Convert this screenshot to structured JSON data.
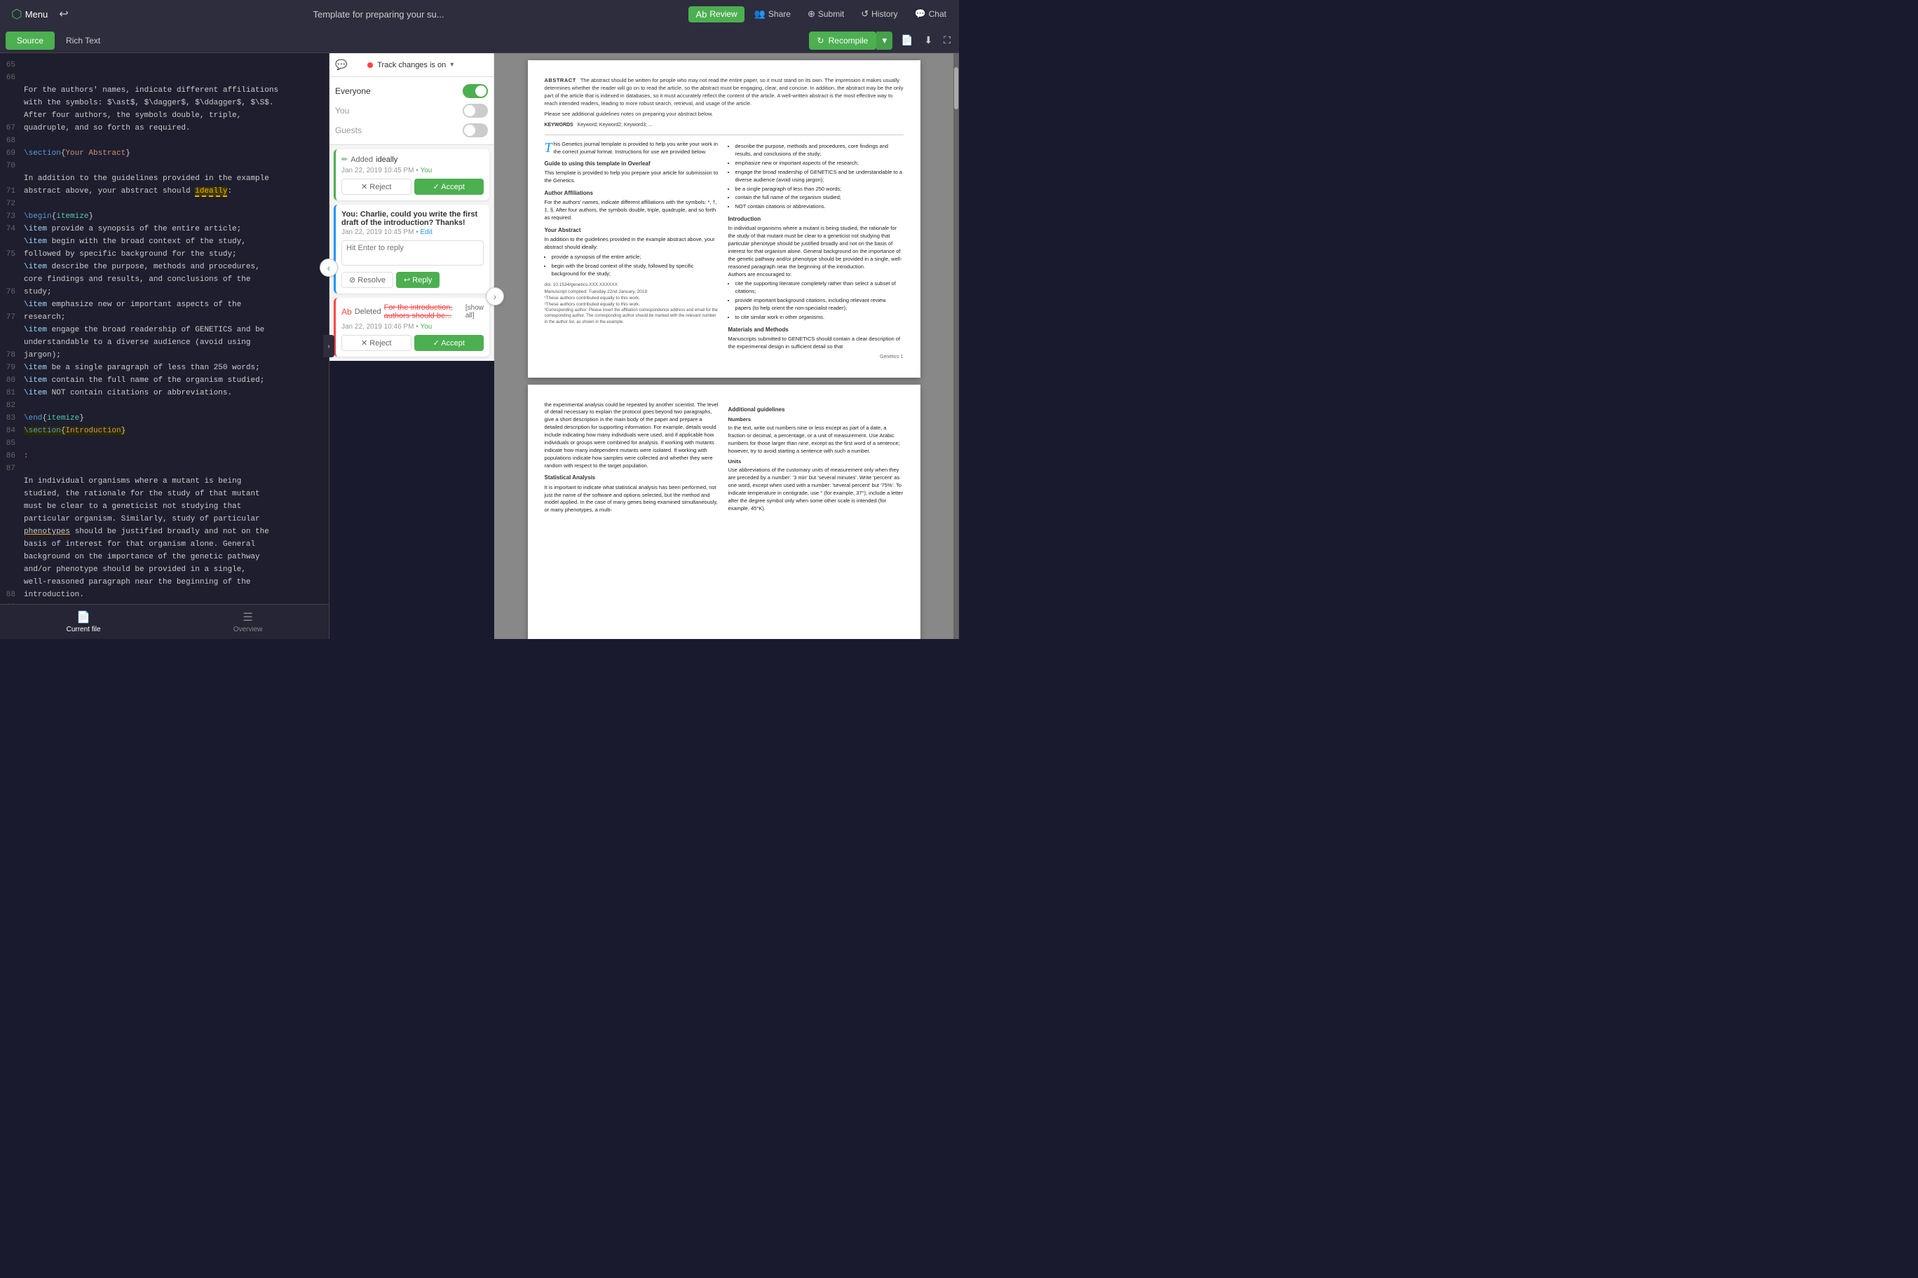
{
  "topbar": {
    "menu_label": "Menu",
    "title": "Template for preparing your su...",
    "review_label": "Review",
    "share_label": "Share",
    "submit_label": "Submit",
    "history_label": "History",
    "chat_label": "Chat"
  },
  "editor_tabs": {
    "source_label": "Source",
    "richtext_label": "Rich Text"
  },
  "toolbar": {
    "recompile_label": "Recompile"
  },
  "track_changes": {
    "indicator": "Track changes is on",
    "everyone_label": "Everyone",
    "you_label": "You",
    "guests_label": "Guests"
  },
  "change_card_1": {
    "action": "Added",
    "text": "ideally",
    "meta": "Jan 22, 2019 10:45 PM",
    "author": "You",
    "reject_label": "✕ Reject",
    "accept_label": "✓ Accept"
  },
  "comment_card": {
    "author": "You:",
    "body": "Charlie, could you write the first draft of the introduction? Thanks!",
    "meta": "Jan 22, 2019 10:45 PM",
    "edit": "Edit",
    "reply_placeholder": "Hit Enter to reply",
    "resolve_label": "⊘ Resolve",
    "reply_label": "↩ Reply"
  },
  "change_card_2": {
    "action": "Deleted",
    "text": "For the introduction, authors should be...",
    "show_all": "[show all]",
    "meta": "Jan 22, 2019 10:46 PM",
    "author": "You",
    "reject_label": "✕ Reject",
    "accept_label": "✓ Accept"
  },
  "bottom_tabs": {
    "current_file_label": "Current file",
    "overview_label": "Overview"
  },
  "code_lines": [
    {
      "num": "65",
      "content": ""
    },
    {
      "num": "66",
      "content": "For the authors' names, indicate different affiliations"
    },
    {
      "num": "",
      "content": "with the symbols: $\\ast$, $\\dagger$, $\\ddagger$, $\\S$."
    },
    {
      "num": "",
      "content": "After four authors, the symbols double, triple,"
    },
    {
      "num": "",
      "content": "quadruple, and so forth as required."
    },
    {
      "num": "67",
      "content": ""
    },
    {
      "num": "68",
      "content": "\\section{Your Abstract}",
      "type": "section"
    },
    {
      "num": "69",
      "content": ""
    },
    {
      "num": "70",
      "content": "In addition to the guidelines provided in the example"
    },
    {
      "num": "",
      "content": "abstract above, your abstract should ideally:"
    },
    {
      "num": "71",
      "content": ""
    },
    {
      "num": "72",
      "content": "\\begin{itemize}",
      "type": "keyword"
    },
    {
      "num": "73",
      "content": "\\item provide a synopsis of the entire article;"
    },
    {
      "num": "74",
      "content": "\\item begin with the broad context of the study,"
    },
    {
      "num": "",
      "content": "followed by specific background for the study;"
    },
    {
      "num": "75",
      "content": "\\item describe the purpose, methods and procedures,"
    },
    {
      "num": "",
      "content": "core findings and results, and conclusions of the"
    },
    {
      "num": "",
      "content": "study;"
    },
    {
      "num": "76",
      "content": "\\item emphasize new or important aspects of the"
    },
    {
      "num": "",
      "content": "research;"
    },
    {
      "num": "77",
      "content": "\\item engage the broad readership of GENETICS and be"
    },
    {
      "num": "",
      "content": "understandable to a diverse audience (avoid using"
    },
    {
      "num": "",
      "content": "jargon);"
    },
    {
      "num": "78",
      "content": "\\item be a single paragraph of less than 250 words;"
    },
    {
      "num": "79",
      "content": "\\item contain the full name of the organism studied;"
    },
    {
      "num": "80",
      "content": "\\item NOT contain citations or abbreviations."
    },
    {
      "num": "81",
      "content": ""
    },
    {
      "num": "82",
      "content": "\\end{itemize}",
      "type": "keyword"
    },
    {
      "num": "83",
      "content": "\\section{Introduction}",
      "type": "section_highlight"
    },
    {
      "num": "84",
      "content": ""
    },
    {
      "num": "85",
      "content": ":",
      "type": "error"
    },
    {
      "num": "86",
      "content": ""
    },
    {
      "num": "87",
      "content": "In individual organisms where a mutant is being"
    },
    {
      "num": "",
      "content": "studied, the rationale for the study of that mutant"
    },
    {
      "num": "",
      "content": "must be clear to a geneticist not studying that"
    },
    {
      "num": "",
      "content": "particular organism. Similarly, study of particular"
    },
    {
      "num": "",
      "content": "phenotypes should be justified broadly and not on the"
    },
    {
      "num": "",
      "content": "basis of interest for that organism alone. General"
    },
    {
      "num": "",
      "content": "background on the importance of the genetic pathway"
    },
    {
      "num": "",
      "content": "and/or phenotype should be provided in a single,"
    },
    {
      "num": "",
      "content": "well-reasoned paragraph near the beginning of the"
    },
    {
      "num": "",
      "content": "introduction."
    }
  ],
  "preview": {
    "abstract_label": "ABSTRACT",
    "abstract_body": "The abstract should be written for people who may not read the entire paper, so it must stand on its own. The impression it makes usually determines whether the reader will go on to read the article, so the abstract must be engaging, clear, and concise. In addition, the abstract may be the only part of the article that is indexed in databases, so it must accurately reflect the content of the article. A well-written abstract is the most effective way to reach intended readers, leading to more robust search, retrieval, and usage of the article.",
    "abstract_note": "Please see additional guidelines notes on preparing your abstract below.",
    "keywords_label": "KEYWORDS",
    "keywords": "Keyword; Keyword2; Keyword3; ...",
    "guide_title": "Guide to using this template in Overleaf",
    "guide_body": "This template is provided to help you prepare your article for submission to the Genetics.",
    "dropcap": "T",
    "dropcap_text": "his Genetics journal template is provided to help you write your work in the correct journal format. Instructions for use are provided below.",
    "right_list": [
      "describe the purpose, methods and procedures, core findings and results, and conclusions of the study;",
      "emphasize new or important aspects of the research;",
      "engage the broad readership of GENETICS and be understandable to a diverse audience (avoid using jargon);",
      "be a single paragraph of less than 250 words;",
      "contain the full name of the organism studied;",
      "NOT contain citations or abbreviations."
    ],
    "affiliations_title": "Author Affiliations",
    "affiliations_body": "For the authors' names, indicate different affiliations with the symbols: *, †, ‡, §. After four authors, the symbols double, triple, quadruple, and so forth as required.",
    "abstract_section_title": "Your Abstract",
    "abstract_section_body": "In addition to the guidelines provided in the example abstract above, your abstract should ideally:",
    "abstract_list": [
      "provide a synopsis of the entire article;",
      "begin with the broad context of the study, followed by specific background for the study;"
    ],
    "doi": "doi: 10.1534/genetics.XXX.XXXXXX",
    "manuscript_date": "Manuscript compiled: Tuesday 22nd January, 2019",
    "footnotes": [
      "¹These authors contributed equally to this work.",
      "²These authors contributed equally to this work.",
      "³Corresponding author: Please insert the affiliation correspondence address and email for the corresponding author. The corresponding author should be marked with the relevant number in the author list, as shown in the example."
    ],
    "intro_title": "Introduction",
    "intro_body": "In individual organisms where a mutant is being studied, the rationale for the study of that mutant must be clear to a geneticist not studying that particular phenotype should be justified broadly and not on the basis of interest for that organism alone. General background on the importance of the genetic pathway and/or phenotype should be provided in a single, well-reasoned paragraph near the beginning of the introduction.",
    "intro_list": [
      "cite the supporting literature completely rather than select a subset of citations;",
      "provide important background citations, including relevant review papers (to help orient the non-specialist reader);",
      "to cite similar work in other organisms."
    ],
    "materials_title": "Materials and Methods",
    "materials_body": "Manuscripts submitted to GENETICS should contain a clear description of the experimental design in sufficient detail so that",
    "page2_body": "the experimental analysis could be repeated by another scientist. The level of detail necessary to explain the protocol goes beyond two paragraphs, give a short description in the main body of the paper and prepare a detailed description for supporting information. For example, details would include indicating how many individuals were used, and if applicable how individuals or groups were combined for analysis. If working with mutants indicate how many independent mutants were isolated. If working with populations indicate how samples were collected and whether they were random with respect to the target population.",
    "additional_title": "Additional guidelines",
    "numbers_title": "Numbers",
    "numbers_body": "In the text, write out numbers nine or less except as part of a date, a fraction or decimal, a percentage, or a unit of measurement. Use Arabic numbers for those larger than nine, except as the first word of a sentence; however, try to avoid starting a sentence with such a number.",
    "units_title": "Units",
    "units_body": "Use abbreviations of the customary units of measurement only when they are preceded by a number: '3 min' but 'several minutes'. Write 'percent' as one word, except when used with a number: 'several percent' but '75%'. To indicate temperature in centigrade, use ° (for example, 37°); include a letter after the degree symbol only when some other scale is intended (for example, 45°K).",
    "stat_title": "Statistical Analysis",
    "stat_body": "It is important to indicate what statistical analysis has been performed, not just the name of the software and options selected, but the method and model applied. In the case of many genes being examined simultaneously, or many phenotypes, a multi-"
  }
}
